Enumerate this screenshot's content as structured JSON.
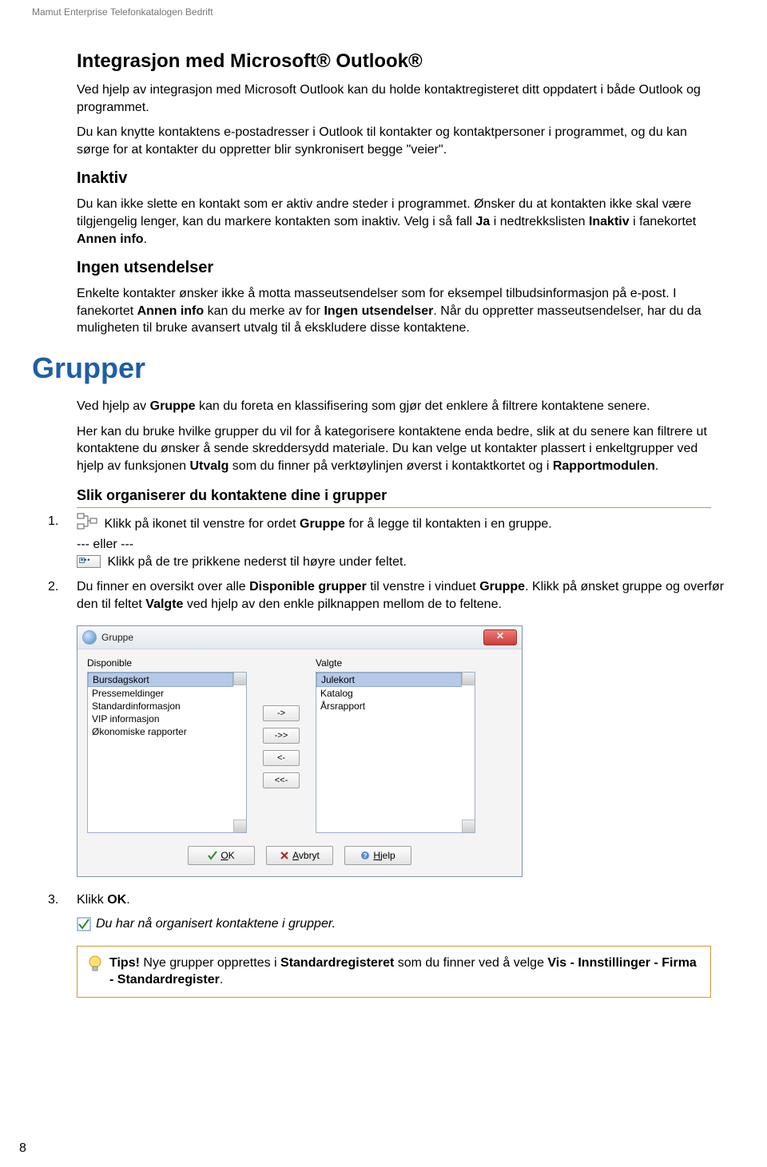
{
  "header": "Mamut Enterprise Telefonkatalogen Bedrift",
  "section1": {
    "title": "Integrasjon med Microsoft® Outlook®",
    "p1": "Ved hjelp av integrasjon med Microsoft Outlook kan du holde kontaktregisteret ditt oppdatert i både Outlook og programmet.",
    "p2": "Du kan knytte kontaktens e-postadresser i Outlook til kontakter og kontaktpersoner i programmet, og du kan sørge for at kontakter du oppretter blir synkronisert begge \"veier\"."
  },
  "inaktiv": {
    "title": "Inaktiv",
    "p_a": "Du kan ikke slette en kontakt som er aktiv andre steder i programmet. Ønsker du at kontakten ikke skal være tilgjengelig lenger, kan du markere kontakten som inaktiv. Velg i så fall ",
    "p_b": " i nedtrekkslisten ",
    "p_c": " i fanekortet ",
    "p_d": ".",
    "ja": "Ja",
    "inaktiv_word": "Inaktiv",
    "annen_info": "Annen info"
  },
  "ingen": {
    "title": "Ingen utsendelser",
    "p_a": "Enkelte kontakter ønsker ikke å motta masseutsendelser som for eksempel tilbudsinformasjon på e-post. I fanekortet ",
    "annen_info": "Annen info",
    "p_b": " kan du merke av for ",
    "ingen_uts": "Ingen utsendelser",
    "p_c": ". Når du oppretter masseutsendelser, har du da muligheten til bruke avansert utvalg til å ekskludere disse kontaktene."
  },
  "grupper": {
    "title": "Grupper",
    "p1_a": "Ved hjelp av ",
    "p1_gruppe": "Gruppe",
    "p1_b": " kan du foreta en klassifisering som gjør det enklere å filtrere kontaktene senere.",
    "p2_a": "Her kan du bruke hvilke grupper du vil for å kategorisere kontaktene enda bedre, slik at du senere kan filtrere ut kontaktene du ønsker å sende skreddersydd materiale. Du kan velge ut kontakter plassert i enkeltgrupper ved hjelp av funksjonen ",
    "p2_utvalg": "Utvalg",
    "p2_b": " som du finner på verktøylinjen øverst i kontaktkortet og i ",
    "p2_rapport": "Rapportmodulen",
    "p2_c": ".",
    "sub": "Slik organiserer du kontaktene dine i grupper",
    "step1_num": "1.",
    "step1_a": "Klikk på ikonet til venstre for ordet ",
    "step1_gruppe": "Gruppe",
    "step1_b": " for å legge til kontakten i en gruppe.",
    "step1_or": "--- eller ---",
    "step1_c": "Klikk på de tre prikkene nederst til høyre under feltet.",
    "step2_num": "2.",
    "step2_a": "Du finner en oversikt over alle ",
    "step2_disp": "Disponible grupper",
    "step2_b": " til venstre i vinduet ",
    "step2_gruppe": "Gruppe",
    "step2_c": ". Klikk på ønsket gruppe og overfør den til feltet ",
    "step2_valgte": "Valgte",
    "step2_d": " ved hjelp av den enkle pilknappen mellom de to feltene.",
    "step3_num": "3.",
    "step3_a": "Klikk ",
    "step3_ok": "OK",
    "step3_b": "."
  },
  "dialog": {
    "title": "Gruppe",
    "left_label": "Disponible",
    "right_label": "Valgte",
    "left_items": [
      "Bursdagskort",
      "Pressemeldinger",
      "Standardinformasjon",
      "VIP informasjon",
      "Økonomiske rapporter"
    ],
    "right_items": [
      "Julekort",
      "Katalog",
      "Årsrapport"
    ],
    "btn_add": "->",
    "btn_addall": "->>",
    "btn_remove": "<-",
    "btn_removeall": "<<-",
    "ok_u": "O",
    "ok_rest": "K",
    "avbryt_u": "A",
    "avbryt_rest": "vbryt",
    "hjelp_u": "H",
    "hjelp_rest": "jelp"
  },
  "done": "Du har nå organisert kontaktene i grupper.",
  "tip": {
    "lead": "Tips!",
    "a": " Nye grupper opprettes i ",
    "standardreg": "Standardregisteret",
    "b": " som du finner ved å velge ",
    "path": "Vis - Innstillinger - Firma - Standardregister",
    "c": "."
  },
  "page_number": "8"
}
